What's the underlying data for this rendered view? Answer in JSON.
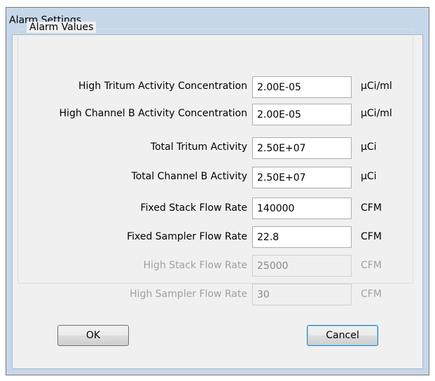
{
  "window": {
    "title": "Alarm Settings"
  },
  "group": {
    "title": "Alarm Values"
  },
  "rows": [
    {
      "label": "High Tritum Activity Concentration",
      "value": "2.00E-05",
      "unit": "µCi/ml",
      "enabled": true
    },
    {
      "label": "High Channel B Activity Concentration",
      "value": "2.00E-05",
      "unit": "µCi/ml",
      "enabled": true
    },
    {
      "label": "Total Tritum Activity",
      "value": "2.50E+07",
      "unit": "µCi",
      "enabled": true
    },
    {
      "label": "Total Channel B Activity",
      "value": "2.50E+07",
      "unit": "µCi",
      "enabled": true
    },
    {
      "label": "Fixed Stack Flow Rate",
      "value": "140000",
      "unit": "CFM",
      "enabled": true
    },
    {
      "label": "Fixed Sampler Flow Rate",
      "value": "22.8",
      "unit": "CFM",
      "enabled": true
    },
    {
      "label": "High Stack Flow Rate",
      "value": "25000",
      "unit": "CFM",
      "enabled": false
    },
    {
      "label": "High Sampler Flow Rate",
      "value": "30",
      "unit": "CFM",
      "enabled": false
    }
  ],
  "buttons": {
    "ok": "OK",
    "cancel": "Cancel"
  }
}
